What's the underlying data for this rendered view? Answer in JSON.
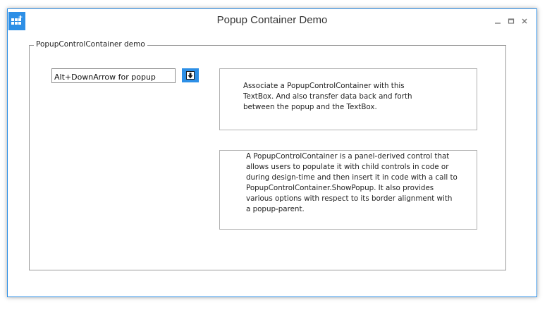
{
  "window": {
    "title": "Popup Container Demo",
    "accent_color": "#2d8fe6",
    "controls": {
      "minimize_glyph": "_",
      "maximize_glyph": "□",
      "close_glyph": "x"
    }
  },
  "group": {
    "legend": "PopupControlContainer demo"
  },
  "textbox": {
    "value": "Alt+DownArrow for popup"
  },
  "dropdown_button": {
    "icon": "arrow-down-icon"
  },
  "info_panels": [
    {
      "text": "Associate a PopupControlContainer with this TextBox. And also transfer data back and forth between the popup and the TextBox."
    },
    {
      "text": "A PopupControlContainer is a panel-derived control that allows users to populate it with child controls in code or during design-time and then insert it in code with a call to PopupControlContainer.ShowPopup. It also provides various options with respect to its border alignment with a popup-parent."
    }
  ]
}
